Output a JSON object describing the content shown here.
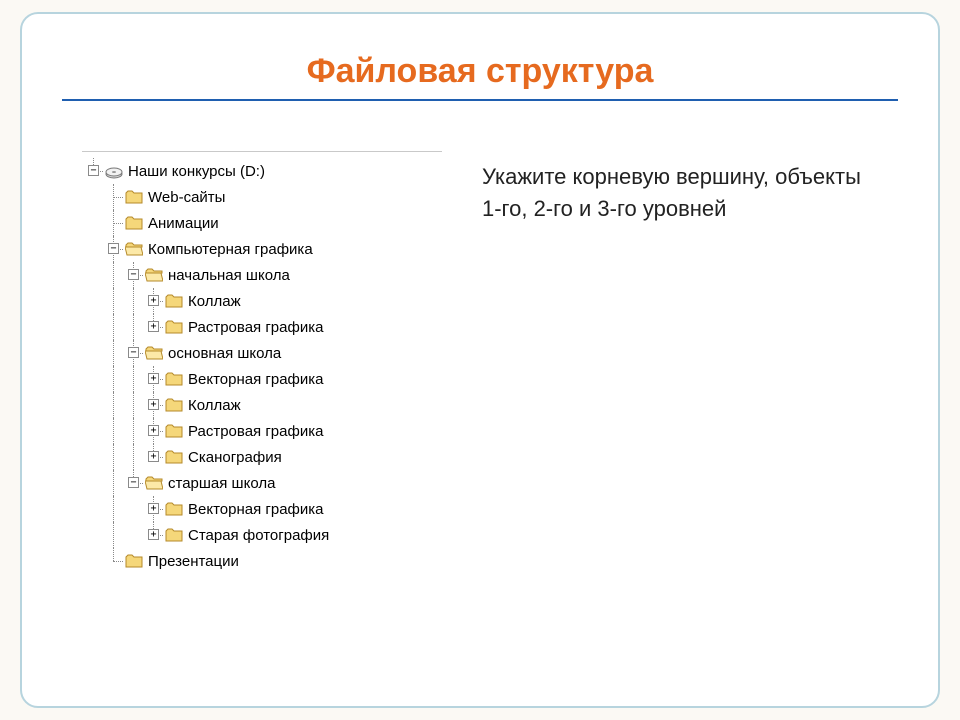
{
  "title": "Файловая структура",
  "task_text": "Укажите корневую вершину, объекты 1-го, 2-го и 3-го уровней",
  "expander": {
    "plus": "+",
    "minus": "−"
  },
  "tree": {
    "root": "Наши конкурсы (D:)",
    "l1_web": "Web-сайты",
    "l1_anim": "Анимации",
    "l1_graf": "Компьютерная графика",
    "l1_prez": "Презентации",
    "l2_nsh": "начальная школа",
    "l2_osh": "основная школа",
    "l2_ssh": "старшая школа",
    "l3_nsh_kollazh": "Коллаж",
    "l3_nsh_rast": "Растровая графика",
    "l3_osh_vekt": "Векторная графика",
    "l3_osh_kollazh": "Коллаж",
    "l3_osh_rast": "Растровая графика",
    "l3_osh_skan": "Сканография",
    "l3_ssh_vekt": "Векторная графика",
    "l3_ssh_foto": "Старая фотография"
  }
}
